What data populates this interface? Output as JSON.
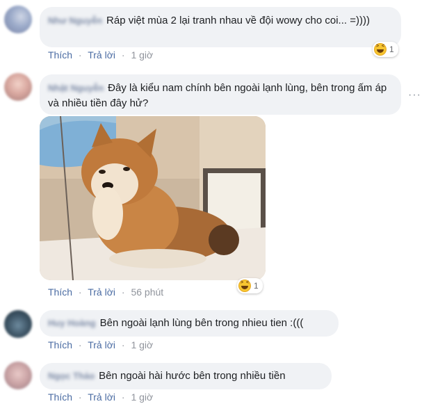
{
  "actions": {
    "like": "Thích",
    "reply": "Trả lời",
    "separator": "·"
  },
  "comments": [
    {
      "name": "Như Nguyễn",
      "text": "Ráp việt mùa 2 lại tranh nhau về đội wowy cho coi... =))))",
      "time": "1 giờ",
      "reaction_count": "1"
    },
    {
      "name": "Nhật Nguyễn",
      "text": "Đây là kiểu nam chính bên ngoài lạnh lùng, bên trong ấm áp và nhiều tiền đây hử?",
      "time": "56 phút",
      "reaction_count": "1"
    },
    {
      "name": "Huy Hoàng",
      "text": "Bên ngoài lạnh lùng bên trong nhieu tien :(((",
      "time": "1 giờ"
    },
    {
      "name": "Ngọc Thảo",
      "text": "Bên ngoài hài hước bên trong nhiều tiền",
      "time": "1 giờ"
    }
  ],
  "more_options": "···"
}
